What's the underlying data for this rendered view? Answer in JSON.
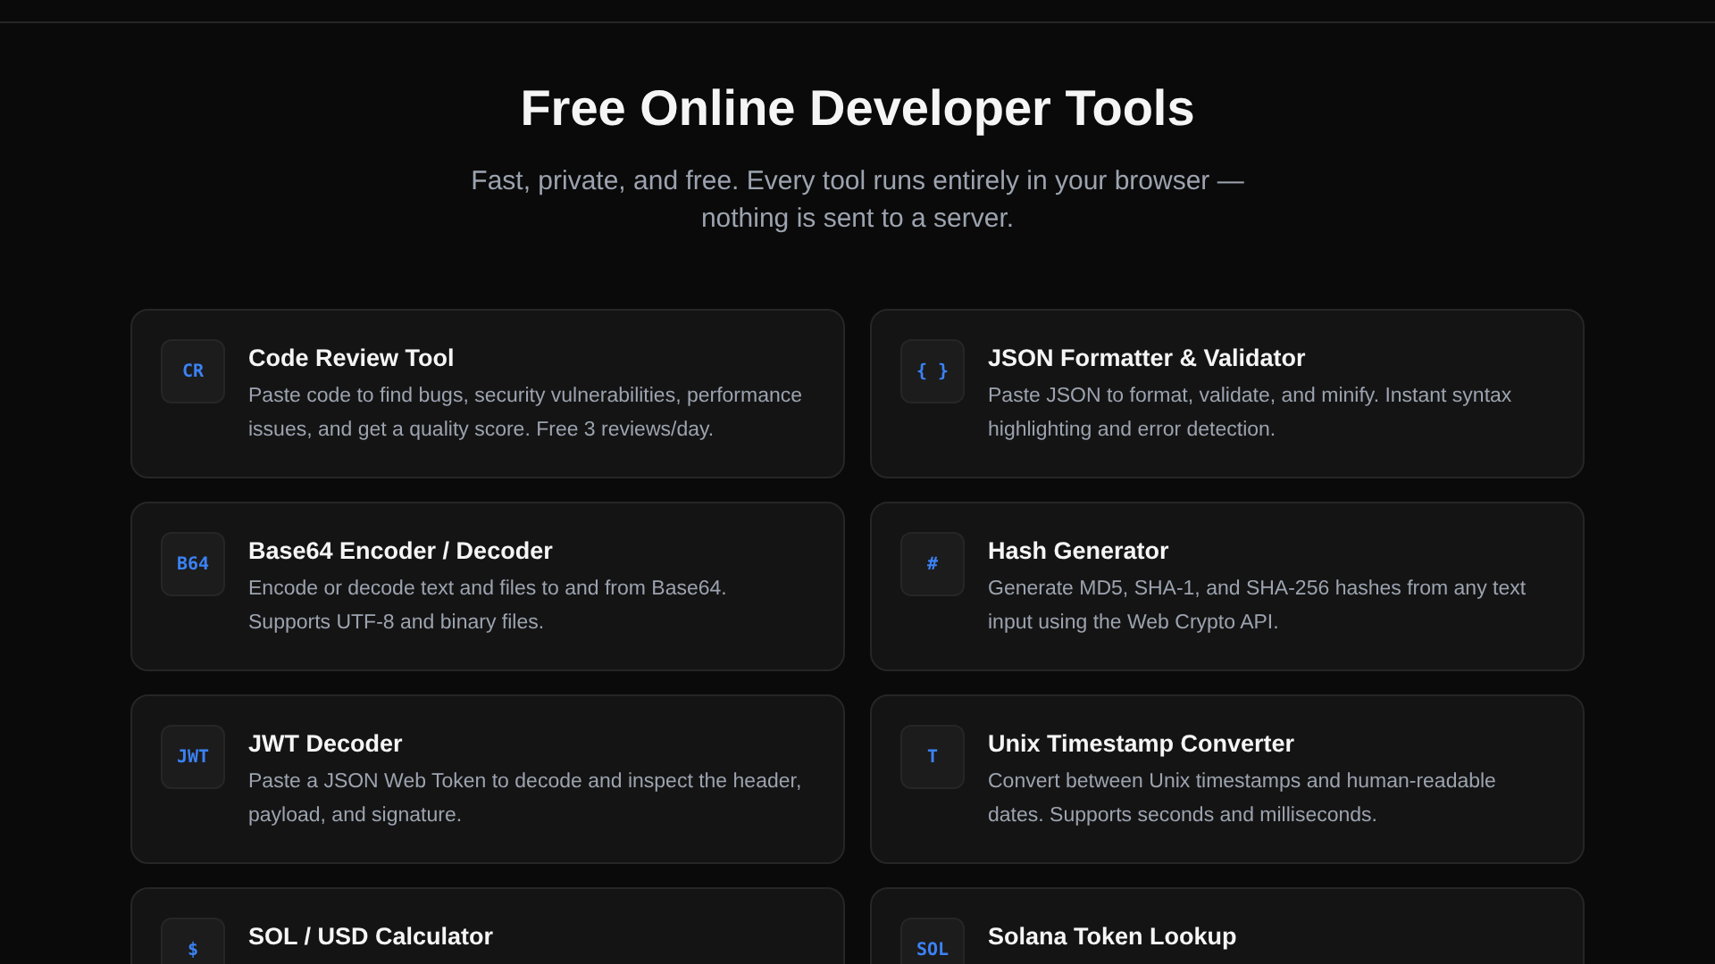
{
  "title": "Free Online Developer Tools",
  "subtitle": "Fast, private, and free. Every tool runs entirely in your browser — nothing is sent to a server.",
  "tools": [
    {
      "badge": "CR",
      "name": "Code Review Tool",
      "description": "Paste code to find bugs, security vulnerabilities, performance issues, and get a quality score. Free 3 reviews/day."
    },
    {
      "badge": "{ }",
      "name": "JSON Formatter & Validator",
      "description": "Paste JSON to format, validate, and minify. Instant syntax highlighting and error detection."
    },
    {
      "badge": "B64",
      "name": "Base64 Encoder / Decoder",
      "description": "Encode or decode text and files to and from Base64. Supports UTF-8 and binary files."
    },
    {
      "badge": "#",
      "name": "Hash Generator",
      "description": "Generate MD5, SHA-1, and SHA-256 hashes from any text input using the Web Crypto API."
    },
    {
      "badge": "JWT",
      "name": "JWT Decoder",
      "description": "Paste a JSON Web Token to decode and inspect the header, payload, and signature."
    },
    {
      "badge": "T",
      "name": "Unix Timestamp Converter",
      "description": "Convert between Unix timestamps and human-readable dates. Supports seconds and milliseconds."
    },
    {
      "badge": "$",
      "name": "SOL / USD Calculator"
    },
    {
      "badge": "SOL",
      "name": "Solana Token Lookup"
    }
  ]
}
